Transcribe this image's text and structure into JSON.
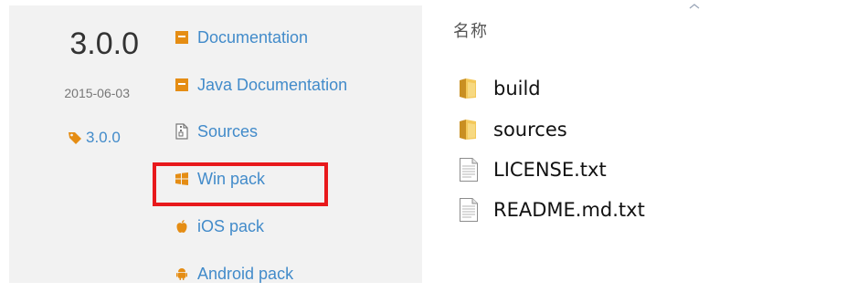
{
  "release": {
    "version": "3.0.0",
    "date": "2015-06-03",
    "tag": "3.0.0",
    "links": [
      {
        "label": "Documentation",
        "icon": "book-icon"
      },
      {
        "label": "Java Documentation",
        "icon": "book-icon"
      },
      {
        "label": "Sources",
        "icon": "zip-file-icon"
      },
      {
        "label": "Win pack",
        "icon": "windows-logo-icon",
        "highlighted": true
      },
      {
        "label": "iOS pack",
        "icon": "apple-logo-icon"
      },
      {
        "label": "Android pack",
        "icon": "android-logo-icon"
      }
    ]
  },
  "explorer": {
    "column_header": "名称",
    "files": [
      {
        "name": "build",
        "type": "folder",
        "icon": "folder-icon"
      },
      {
        "name": "sources",
        "type": "folder",
        "icon": "folder-icon"
      },
      {
        "name": "LICENSE.txt",
        "type": "text-file",
        "icon": "text-file-icon"
      },
      {
        "name": "README.md.txt",
        "type": "text-file",
        "icon": "text-file-icon"
      }
    ]
  },
  "colors": {
    "link": "#428bca",
    "icon_orange": "#e58d14",
    "highlight_border": "#e8191c",
    "panel_bg": "#f2f2f2",
    "folder": "#e9b949"
  }
}
